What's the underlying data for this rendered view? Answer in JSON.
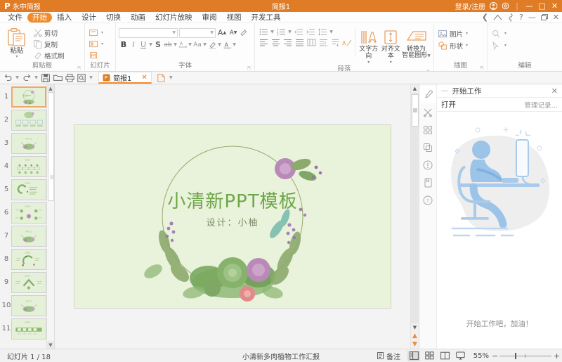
{
  "titlebar": {
    "app_name": "永中简报",
    "logo_letter": "P",
    "doc_title": "简报1",
    "login_label": "登录/注册",
    "settings_icon": "gear-icon",
    "minimize": "—",
    "maximize": "□",
    "close": "✕"
  },
  "ribbon_tabs": [
    {
      "label": "文件",
      "active": false
    },
    {
      "label": "开始",
      "active": true
    },
    {
      "label": "插入",
      "active": false
    },
    {
      "label": "设计",
      "active": false
    },
    {
      "label": "切换",
      "active": false
    },
    {
      "label": "动画",
      "active": false
    },
    {
      "label": "幻灯片放映",
      "active": false
    },
    {
      "label": "审阅",
      "active": false
    },
    {
      "label": "视图",
      "active": false
    },
    {
      "label": "开发工具",
      "active": false
    }
  ],
  "tabstrip_right": {
    "back_icon": "chevron-left-icon",
    "cloud_icon": "cloud-icon",
    "hand_icon": "hand-icon",
    "help_icon": "?",
    "minimize_icon": "—",
    "restore_icon": "▭",
    "close_icon": "✕"
  },
  "ribbon": {
    "groups": [
      {
        "label": "剪贴板",
        "has_dialog_launcher": true,
        "paste": {
          "label": "粘贴",
          "icon": "paste-icon",
          "caret": "▾"
        },
        "items": [
          {
            "label": "剪切",
            "icon": "scissors-icon"
          },
          {
            "label": "复制",
            "icon": "copy-icon"
          },
          {
            "label": "格式刷",
            "icon": "format-painter-icon"
          }
        ]
      },
      {
        "label": "幻灯片",
        "has_dialog_launcher": false,
        "items": [
          {
            "icon": "new-slide-icon",
            "caret": "▾"
          },
          {
            "icon": "layout-icon",
            "caret": "▾"
          },
          {
            "icon": "reset-slide-icon",
            "caret": ""
          }
        ]
      },
      {
        "label": "字体",
        "has_dialog_launcher": true,
        "font_name_value": "",
        "font_size_value": "",
        "grow_font": "A",
        "shrink_font": "A",
        "clear_format_icon": "eraser-icon",
        "buttons": [
          {
            "label": "B",
            "name": "bold"
          },
          {
            "label": "I",
            "name": "italic"
          },
          {
            "label": "U",
            "name": "underline"
          },
          {
            "label": "S",
            "name": "shadow"
          },
          {
            "label": "ab",
            "name": "strikethrough"
          },
          {
            "label": "A",
            "name": "character-spacing"
          },
          {
            "label": "Aa",
            "name": "change-case"
          },
          {
            "label": "A",
            "name": "text-highlight"
          },
          {
            "label": "A",
            "name": "font-color"
          }
        ]
      },
      {
        "label": "段落",
        "has_dialog_launcher": true,
        "row1": [
          {
            "icon": "bullets-icon",
            "caret": "▾"
          },
          {
            "icon": "numbering-icon",
            "caret": "▾"
          },
          {
            "icon": "decrease-indent-icon",
            "caret": ""
          },
          {
            "icon": "increase-indent-icon",
            "caret": ""
          },
          {
            "icon": "line-spacing-icon",
            "caret": "▾"
          }
        ],
        "row2": [
          {
            "icon": "align-left-icon"
          },
          {
            "icon": "align-center-icon"
          },
          {
            "icon": "align-right-icon"
          },
          {
            "icon": "align-justify-icon"
          },
          {
            "icon": "distribute-icon"
          },
          {
            "icon": "columns-icon"
          },
          {
            "icon": "text-direction-vertical-icon"
          },
          {
            "icon": "clear-formatting-icon"
          }
        ],
        "big_buttons": [
          {
            "label": "文字方向",
            "icon": "text-direction-icon",
            "caret": "▾"
          },
          {
            "label": "对齐文本",
            "icon": "align-text-icon",
            "caret": "▾"
          },
          {
            "label": "转换为",
            "label2": "智能图形",
            "icon": "smartart-icon",
            "caret": "▾"
          }
        ]
      },
      {
        "label": "插图",
        "has_dialog_launcher": true,
        "items": [
          {
            "label": "图片",
            "icon": "picture-icon",
            "caret": "▾"
          },
          {
            "label": "形状",
            "icon": "shapes-icon",
            "caret": "▾"
          }
        ]
      },
      {
        "label": "编辑",
        "has_dialog_launcher": false,
        "items": [
          {
            "label": "",
            "icon": "search-icon",
            "caret": "▾"
          },
          {
            "label": "",
            "icon": "select-arrow-icon",
            "caret": "▾"
          }
        ]
      }
    ]
  },
  "quickaccess": {
    "items": [
      {
        "icon": "undo-icon",
        "caret": "▾"
      },
      {
        "icon": "redo-icon",
        "caret": "▾"
      },
      {
        "icon": "save-icon",
        "caret": ""
      },
      {
        "icon": "open-icon",
        "caret": ""
      },
      {
        "icon": "print-icon",
        "caret": ""
      },
      {
        "icon": "print-preview-icon",
        "caret": ""
      },
      {
        "icon": "customize-icon",
        "caret": ""
      }
    ],
    "doc_tab": {
      "label": "简报1",
      "icon": "ppt-file-icon",
      "close": "✕"
    },
    "new_tab": {
      "icon": "new-doc-icon",
      "caret": "▾"
    }
  },
  "thumbnails": {
    "selected_index": 1,
    "slides": [
      {
        "num": "1",
        "kind": "title"
      },
      {
        "num": "2",
        "kind": "toc"
      },
      {
        "num": "3",
        "kind": "section"
      },
      {
        "num": "4",
        "kind": "grid4"
      },
      {
        "num": "5",
        "kind": "chart"
      },
      {
        "num": "6",
        "kind": "circles"
      },
      {
        "num": "7",
        "kind": "section"
      },
      {
        "num": "8",
        "kind": "arc"
      },
      {
        "num": "9",
        "kind": "pyramid"
      },
      {
        "num": "10",
        "kind": "section"
      },
      {
        "num": "11",
        "kind": "timeline"
      }
    ]
  },
  "slide": {
    "title": "小清新PPT模板",
    "subtitle": "设计：小柚",
    "bg_color": "#e9f2da",
    "title_color": "#6fa64a"
  },
  "rightpanel": {
    "title": "开始工作",
    "close": "✕",
    "open_label": "打开",
    "manage_label": "管理记录…",
    "caption": "开始工作吧，加油！",
    "side_icons": [
      {
        "name": "eyedropper-icon",
        "active": true
      },
      {
        "name": "scissors-icon",
        "active": false
      },
      {
        "name": "grid-icon",
        "active": false
      },
      {
        "name": "duplicate-icon",
        "active": false
      },
      {
        "name": "info-icon",
        "active": false
      },
      {
        "name": "book-icon",
        "active": false
      },
      {
        "name": "help-icon",
        "active": false
      }
    ]
  },
  "statusbar": {
    "slide_counter": "幻灯片 1 / 18",
    "doc_name": "小清新多肉植物工作汇报",
    "notes_label": "备注",
    "views": [
      {
        "name": "normal-view",
        "selected": true
      },
      {
        "name": "slide-sorter-view",
        "selected": false
      },
      {
        "name": "reading-view",
        "selected": false
      },
      {
        "name": "slideshow-view",
        "selected": false
      }
    ],
    "zoom_level": "55%",
    "zoom_minus": "−",
    "zoom_plus": "+"
  },
  "colors": {
    "brand_orange": "#e07b26",
    "tab_active": "#f08c2e",
    "slide_green": "#e9f2da",
    "panel_blue": "#9cc3e8"
  }
}
